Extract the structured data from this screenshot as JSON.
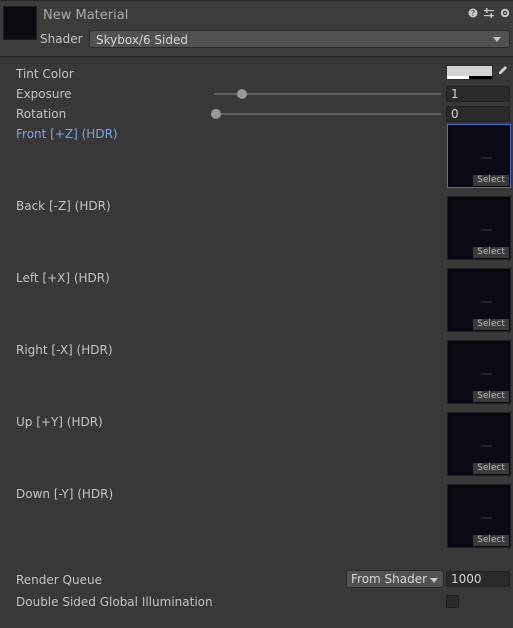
{
  "header": {
    "material_name": "New Material",
    "shader_label": "Shader",
    "shader_value": "Skybox/6 Sided",
    "icons": [
      "help-icon",
      "presets-icon",
      "settings-icon"
    ]
  },
  "properties": {
    "tint_color": {
      "label": "Tint Color",
      "color": "#d2d2d2"
    },
    "exposure": {
      "label": "Exposure",
      "value": "1",
      "slider_fraction": 0.125
    },
    "rotation": {
      "label": "Rotation",
      "value": "0",
      "slider_fraction": 0.0
    },
    "textures": [
      {
        "label": "Front [+Z]   (HDR)",
        "select": "Select",
        "active": true
      },
      {
        "label": "Back [-Z]   (HDR)",
        "select": "Select",
        "active": false
      },
      {
        "label": "Left [+X]   (HDR)",
        "select": "Select",
        "active": false
      },
      {
        "label": "Right [-X]   (HDR)",
        "select": "Select",
        "active": false
      },
      {
        "label": "Up [+Y]   (HDR)",
        "select": "Select",
        "active": false
      },
      {
        "label": "Down [-Y]   (HDR)",
        "select": "Select",
        "active": false
      }
    ]
  },
  "footer": {
    "render_queue_label": "Render Queue",
    "render_queue_mode": "From Shader",
    "render_queue_value": "1000",
    "double_sided_gi_label": "Double Sided Global Illumination",
    "double_sided_gi_checked": false
  },
  "colors": {
    "background": "#383838",
    "active_label": "#7ba6e4",
    "active_border": "#4a6bd0"
  }
}
